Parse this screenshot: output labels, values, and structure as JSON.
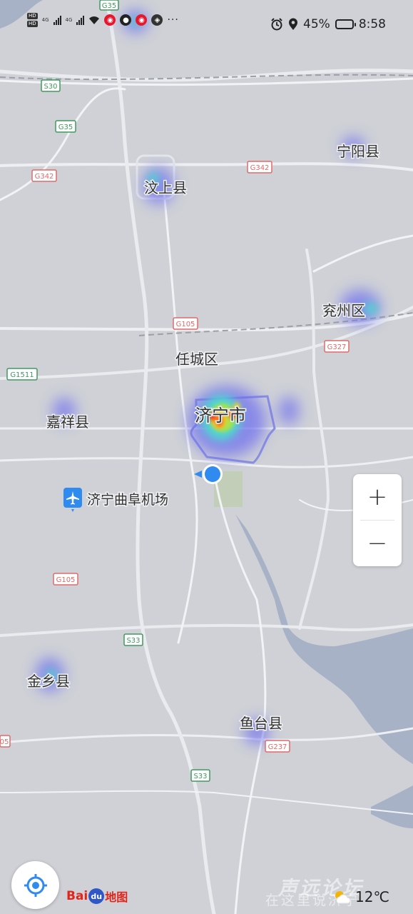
{
  "status_bar": {
    "time": "8:58",
    "battery": "45%",
    "hd_top": "HD",
    "hd_bottom": "HD",
    "sim1": "4G",
    "sim2": "4G",
    "more": "···"
  },
  "map": {
    "roads": {
      "g35_top": "G35",
      "s30": "S30",
      "g35": "G35",
      "g342_left": "G342",
      "g342_right": "G342",
      "g105_north": "G105",
      "g1511": "G1511",
      "g327": "G327",
      "g105_south": "G105",
      "s33_north": "S33",
      "g237": "G237",
      "s33_south": "S33",
      "edge_05": "05"
    },
    "places": {
      "wenshang": "汶上县",
      "ningyang": "宁阳县",
      "yanzhou": "兖州区",
      "rencheng": "任城区",
      "jining": "济宁市",
      "jiaxiang": "嘉祥县",
      "airport": "济宁曲阜机场",
      "jinxiang": "金乡县",
      "yutai": "鱼台县"
    }
  },
  "controls": {
    "zoom_in": "+",
    "zoom_out": "−"
  },
  "branding": {
    "bai": "Bai",
    "du": "du",
    "ditu": "地图"
  },
  "weather": {
    "temperature": "12℃",
    "icon": "partly-cloudy-icon"
  },
  "watermark": {
    "line1": "声远论坛",
    "line2": "在这里说济宁"
  },
  "colors": {
    "land": "#cfd1d6",
    "water": "#a7b2c7",
    "road_label_red": "#e06a6a",
    "road_label_green": "#3f9a5b",
    "heat_blue": "#5a5af5",
    "heat_red": "#ff2a1a",
    "accent_blue": "#2f8bf0"
  }
}
